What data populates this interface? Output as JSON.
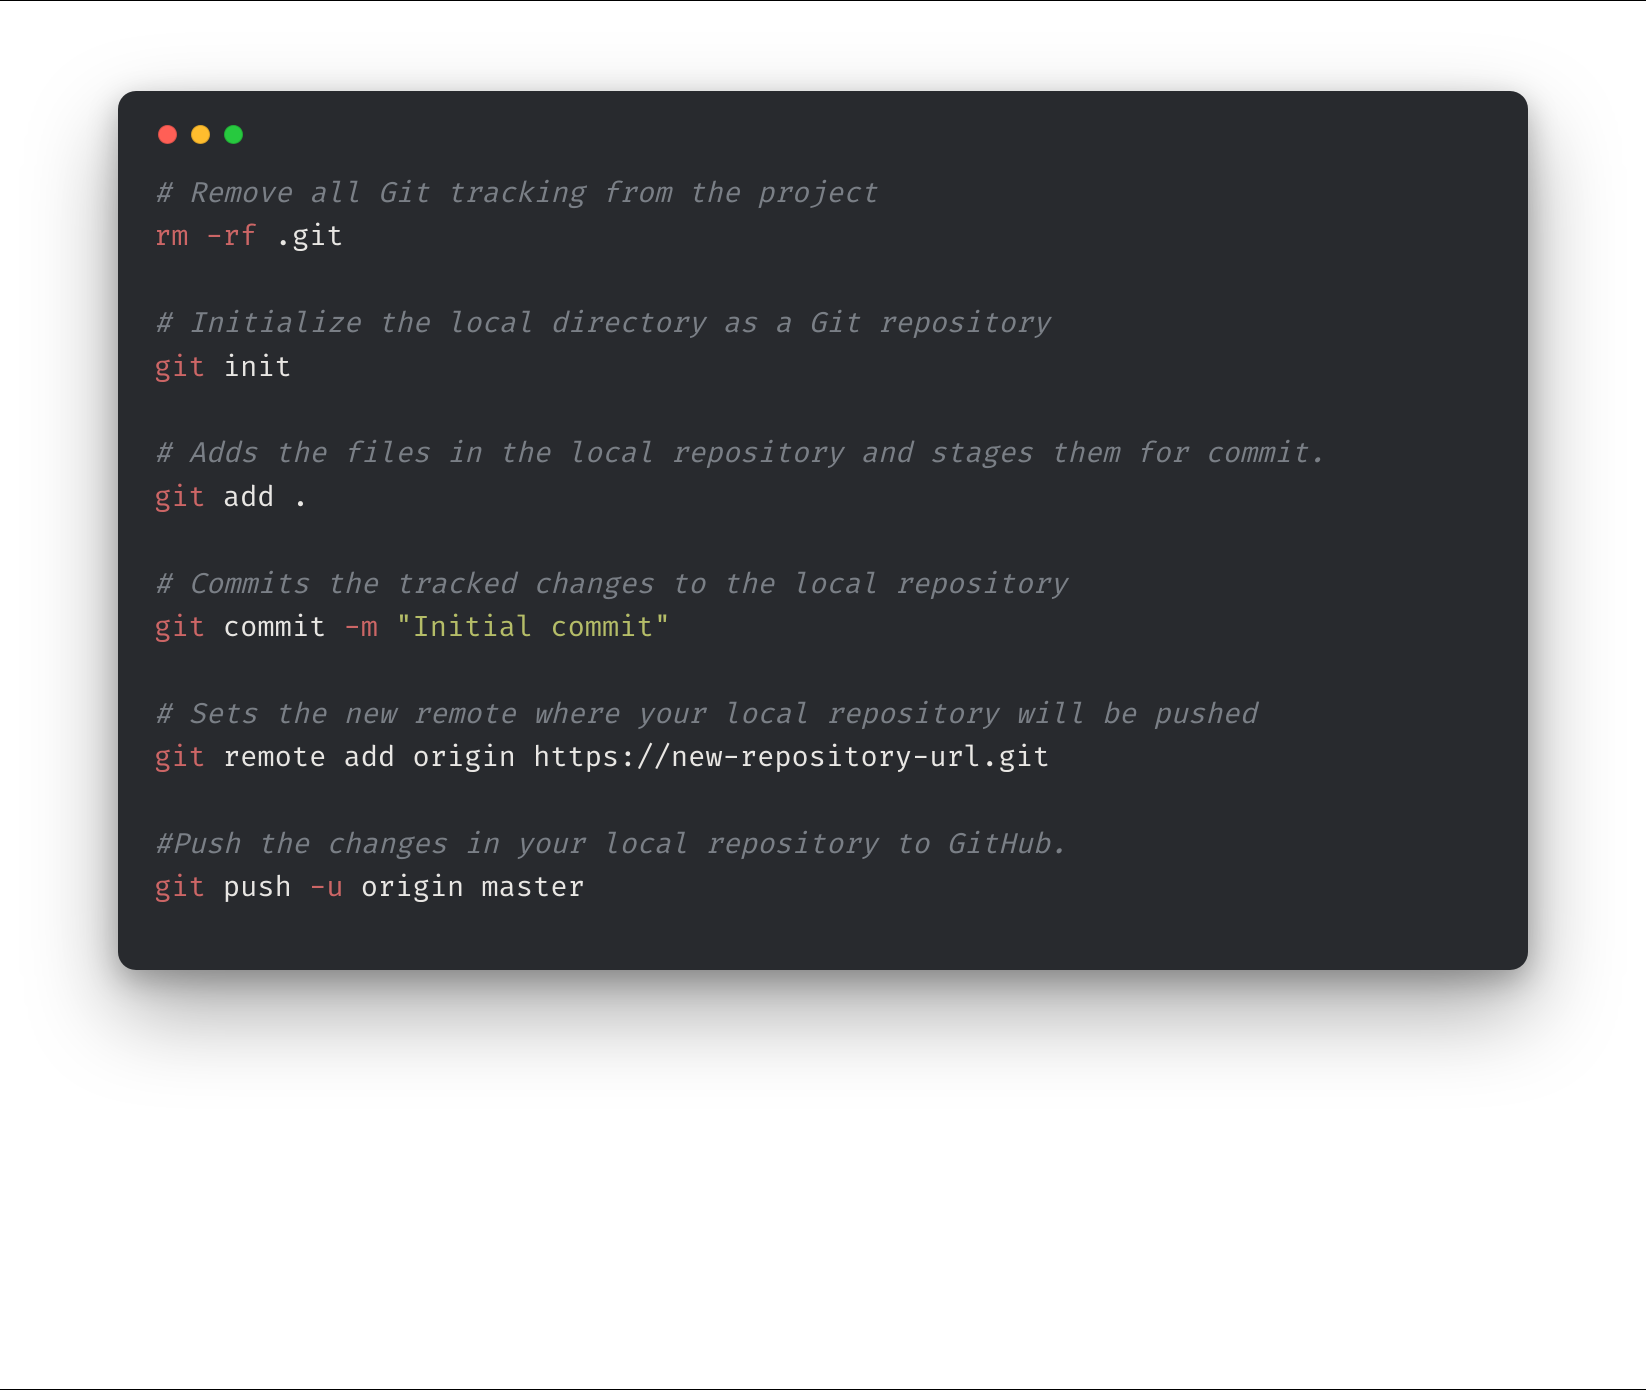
{
  "colors": {
    "window_bg": "#282A2E",
    "comment": "#7A7F86",
    "command": "#CC6666",
    "flag": "#CC6666",
    "text": "#E8E6E3",
    "string": "#B5BD68",
    "dot_red": "#FF5F56",
    "dot_yellow": "#FFBD2E",
    "dot_green": "#27C93F"
  },
  "lines": [
    {
      "type": "comment",
      "text": "# Remove all Git tracking from the project"
    },
    {
      "type": "cmd",
      "tokens": [
        {
          "cls": "cmd",
          "text": "rm"
        },
        {
          "cls": "plain",
          "text": " "
        },
        {
          "cls": "flag",
          "text": "-rf"
        },
        {
          "cls": "plain",
          "text": " .git"
        }
      ]
    },
    {
      "type": "blank"
    },
    {
      "type": "comment",
      "text": "# Initialize the local directory as a Git repository"
    },
    {
      "type": "cmd",
      "tokens": [
        {
          "cls": "cmd",
          "text": "git"
        },
        {
          "cls": "plain",
          "text": " init"
        }
      ]
    },
    {
      "type": "blank"
    },
    {
      "type": "comment",
      "text": "# Adds the files in the local repository and stages them for commit."
    },
    {
      "type": "cmd",
      "tokens": [
        {
          "cls": "cmd",
          "text": "git"
        },
        {
          "cls": "plain",
          "text": " add ."
        }
      ]
    },
    {
      "type": "blank"
    },
    {
      "type": "comment",
      "text": "# Commits the tracked changes to the local repository"
    },
    {
      "type": "cmd",
      "tokens": [
        {
          "cls": "cmd",
          "text": "git"
        },
        {
          "cls": "plain",
          "text": " commit "
        },
        {
          "cls": "flag",
          "text": "-m"
        },
        {
          "cls": "plain",
          "text": " "
        },
        {
          "cls": "str",
          "text": "\"Initial commit\""
        }
      ]
    },
    {
      "type": "blank"
    },
    {
      "type": "comment",
      "text": "# Sets the new remote where your local repository will be pushed"
    },
    {
      "type": "cmd",
      "tokens": [
        {
          "cls": "cmd",
          "text": "git"
        },
        {
          "cls": "plain",
          "text": " remote add origin https://new-repository-url.git"
        }
      ]
    },
    {
      "type": "blank"
    },
    {
      "type": "comment",
      "text": "#Push the changes in your local repository to GitHub."
    },
    {
      "type": "cmd",
      "tokens": [
        {
          "cls": "cmd",
          "text": "git"
        },
        {
          "cls": "plain",
          "text": " push "
        },
        {
          "cls": "flag",
          "text": "-u"
        },
        {
          "cls": "plain",
          "text": " origin master"
        }
      ]
    }
  ]
}
